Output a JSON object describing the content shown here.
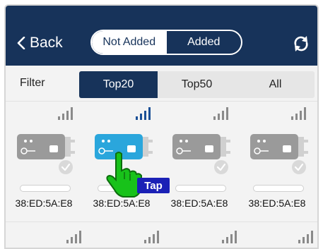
{
  "header": {
    "back_label": "Back",
    "segment": {
      "selected": "Not Added",
      "other": "Added"
    },
    "refresh_icon": "refresh-icon"
  },
  "filter": {
    "label": "Filter",
    "tabs": [
      "Top20",
      "Top50",
      "All"
    ],
    "active_tab": "Top20"
  },
  "devices": [
    {
      "mac": "38:ED:5A:E8",
      "highlighted": false
    },
    {
      "mac": "38:ED:5A:E8",
      "highlighted": true
    },
    {
      "mac": "38:ED:5A:E8",
      "highlighted": false
    },
    {
      "mac": "38:ED:5A:E8",
      "highlighted": false
    }
  ],
  "tap_hint": "Tap",
  "colors": {
    "navy": "#17335a",
    "lock_gray": "#9a9a9a",
    "lock_blue": "#2aa6dc",
    "hand_green": "#18c21a",
    "tap_badge": "#1b21b6"
  }
}
